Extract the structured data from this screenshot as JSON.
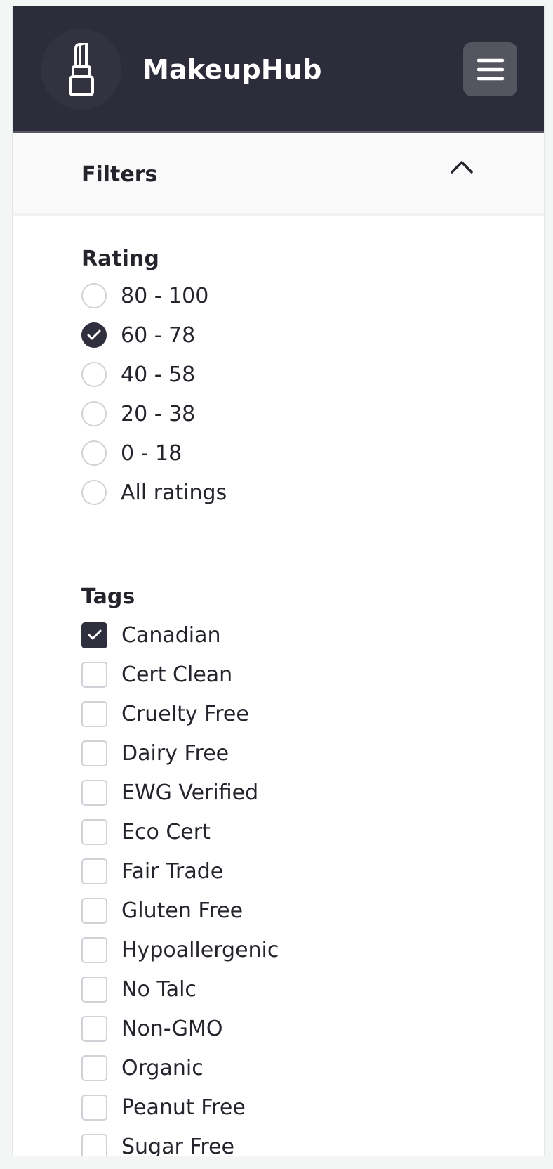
{
  "navbar": {
    "brand": "MakeupHub",
    "logo_icon": "lipstick-icon",
    "menu_icon": "hamburger-menu-icon"
  },
  "filters": {
    "title": "Filters",
    "toggle_icon": "chevron-up-icon",
    "expanded": true
  },
  "rating": {
    "title": "Rating",
    "options": [
      {
        "label": "80 - 100",
        "selected": false
      },
      {
        "label": "60 - 78",
        "selected": true
      },
      {
        "label": "40 - 58",
        "selected": false
      },
      {
        "label": "20 - 38",
        "selected": false
      },
      {
        "label": "0 - 18",
        "selected": false
      },
      {
        "label": "All ratings",
        "selected": false
      }
    ]
  },
  "tags": {
    "title": "Tags",
    "options": [
      {
        "label": "Canadian",
        "checked": true
      },
      {
        "label": "Cert Clean",
        "checked": false
      },
      {
        "label": "Cruelty Free",
        "checked": false
      },
      {
        "label": "Dairy Free",
        "checked": false
      },
      {
        "label": "EWG Verified",
        "checked": false
      },
      {
        "label": "Eco Cert",
        "checked": false
      },
      {
        "label": "Fair Trade",
        "checked": false
      },
      {
        "label": "Gluten Free",
        "checked": false
      },
      {
        "label": "Hypoallergenic",
        "checked": false
      },
      {
        "label": "No Talc",
        "checked": false
      },
      {
        "label": "Non-GMO",
        "checked": false
      },
      {
        "label": "Organic",
        "checked": false
      },
      {
        "label": "Peanut Free",
        "checked": false
      },
      {
        "label": "Sugar Free",
        "checked": false
      }
    ]
  },
  "colors": {
    "navbar_bg": "#2c2c3a",
    "accent": "#2f2f3d"
  }
}
